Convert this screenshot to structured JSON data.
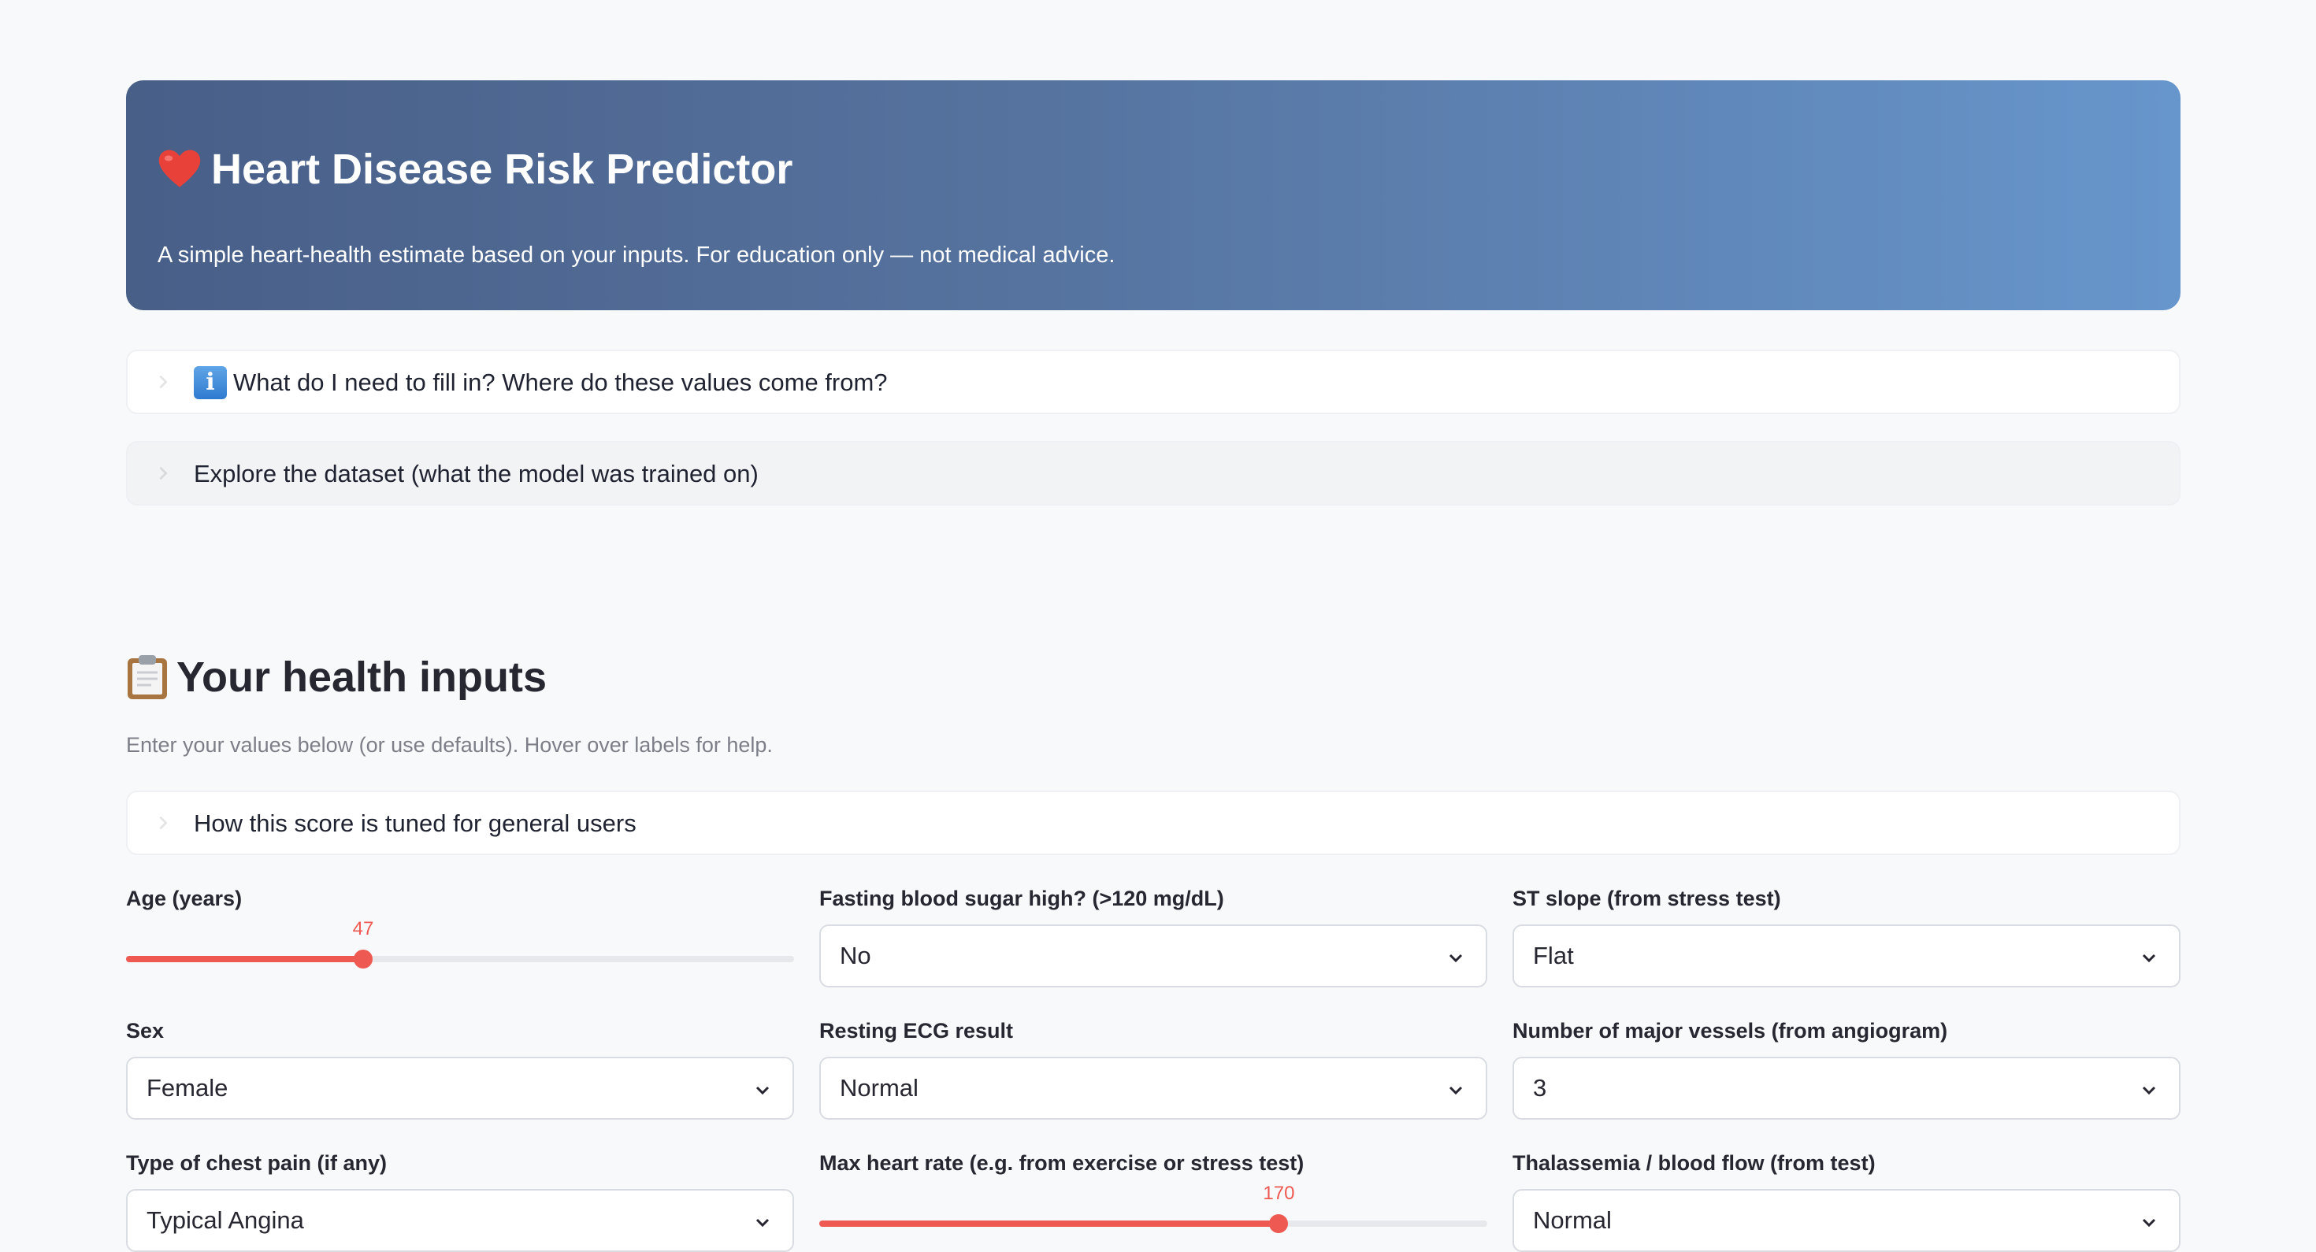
{
  "hero": {
    "title": "Heart Disease Risk Predictor",
    "subtitle": "A simple heart-health estimate based on your inputs. For education only — not medical advice."
  },
  "expanders": {
    "fill_in_help": "What do I need to fill in? Where do these values come from?",
    "explore_dataset": "Explore the dataset (what the model was trained on)",
    "score_tuning": "How this score is tuned for general users"
  },
  "inputs_section": {
    "title": "Your health inputs",
    "caption": "Enter your values below (or use defaults). Hover over labels for help."
  },
  "fields": {
    "age": {
      "label": "Age (years)",
      "value": "47",
      "fraction": 0.355
    },
    "sex": {
      "label": "Sex",
      "value": "Female"
    },
    "chest_pain": {
      "label": "Type of chest pain (if any)",
      "value": "Typical Angina"
    },
    "fasting_blood_sugar": {
      "label": "Fasting blood sugar high? (>120 mg/dL)",
      "value": "No"
    },
    "resting_ecg": {
      "label": "Resting ECG result",
      "value": "Normal"
    },
    "max_heart_rate": {
      "label": "Max heart rate (e.g. from exercise or stress test)",
      "value": "170",
      "fraction": 0.688
    },
    "st_slope": {
      "label": "ST slope (from stress test)",
      "value": "Flat"
    },
    "major_vessels": {
      "label": "Number of major vessels (from angiogram)",
      "value": "3"
    },
    "thalassemia": {
      "label": "Thalassemia / blood flow (from test)",
      "value": "Normal"
    }
  },
  "colors": {
    "accent": "#ee5a52",
    "hero_start": "#485f88",
    "hero_end": "#6796cc"
  }
}
